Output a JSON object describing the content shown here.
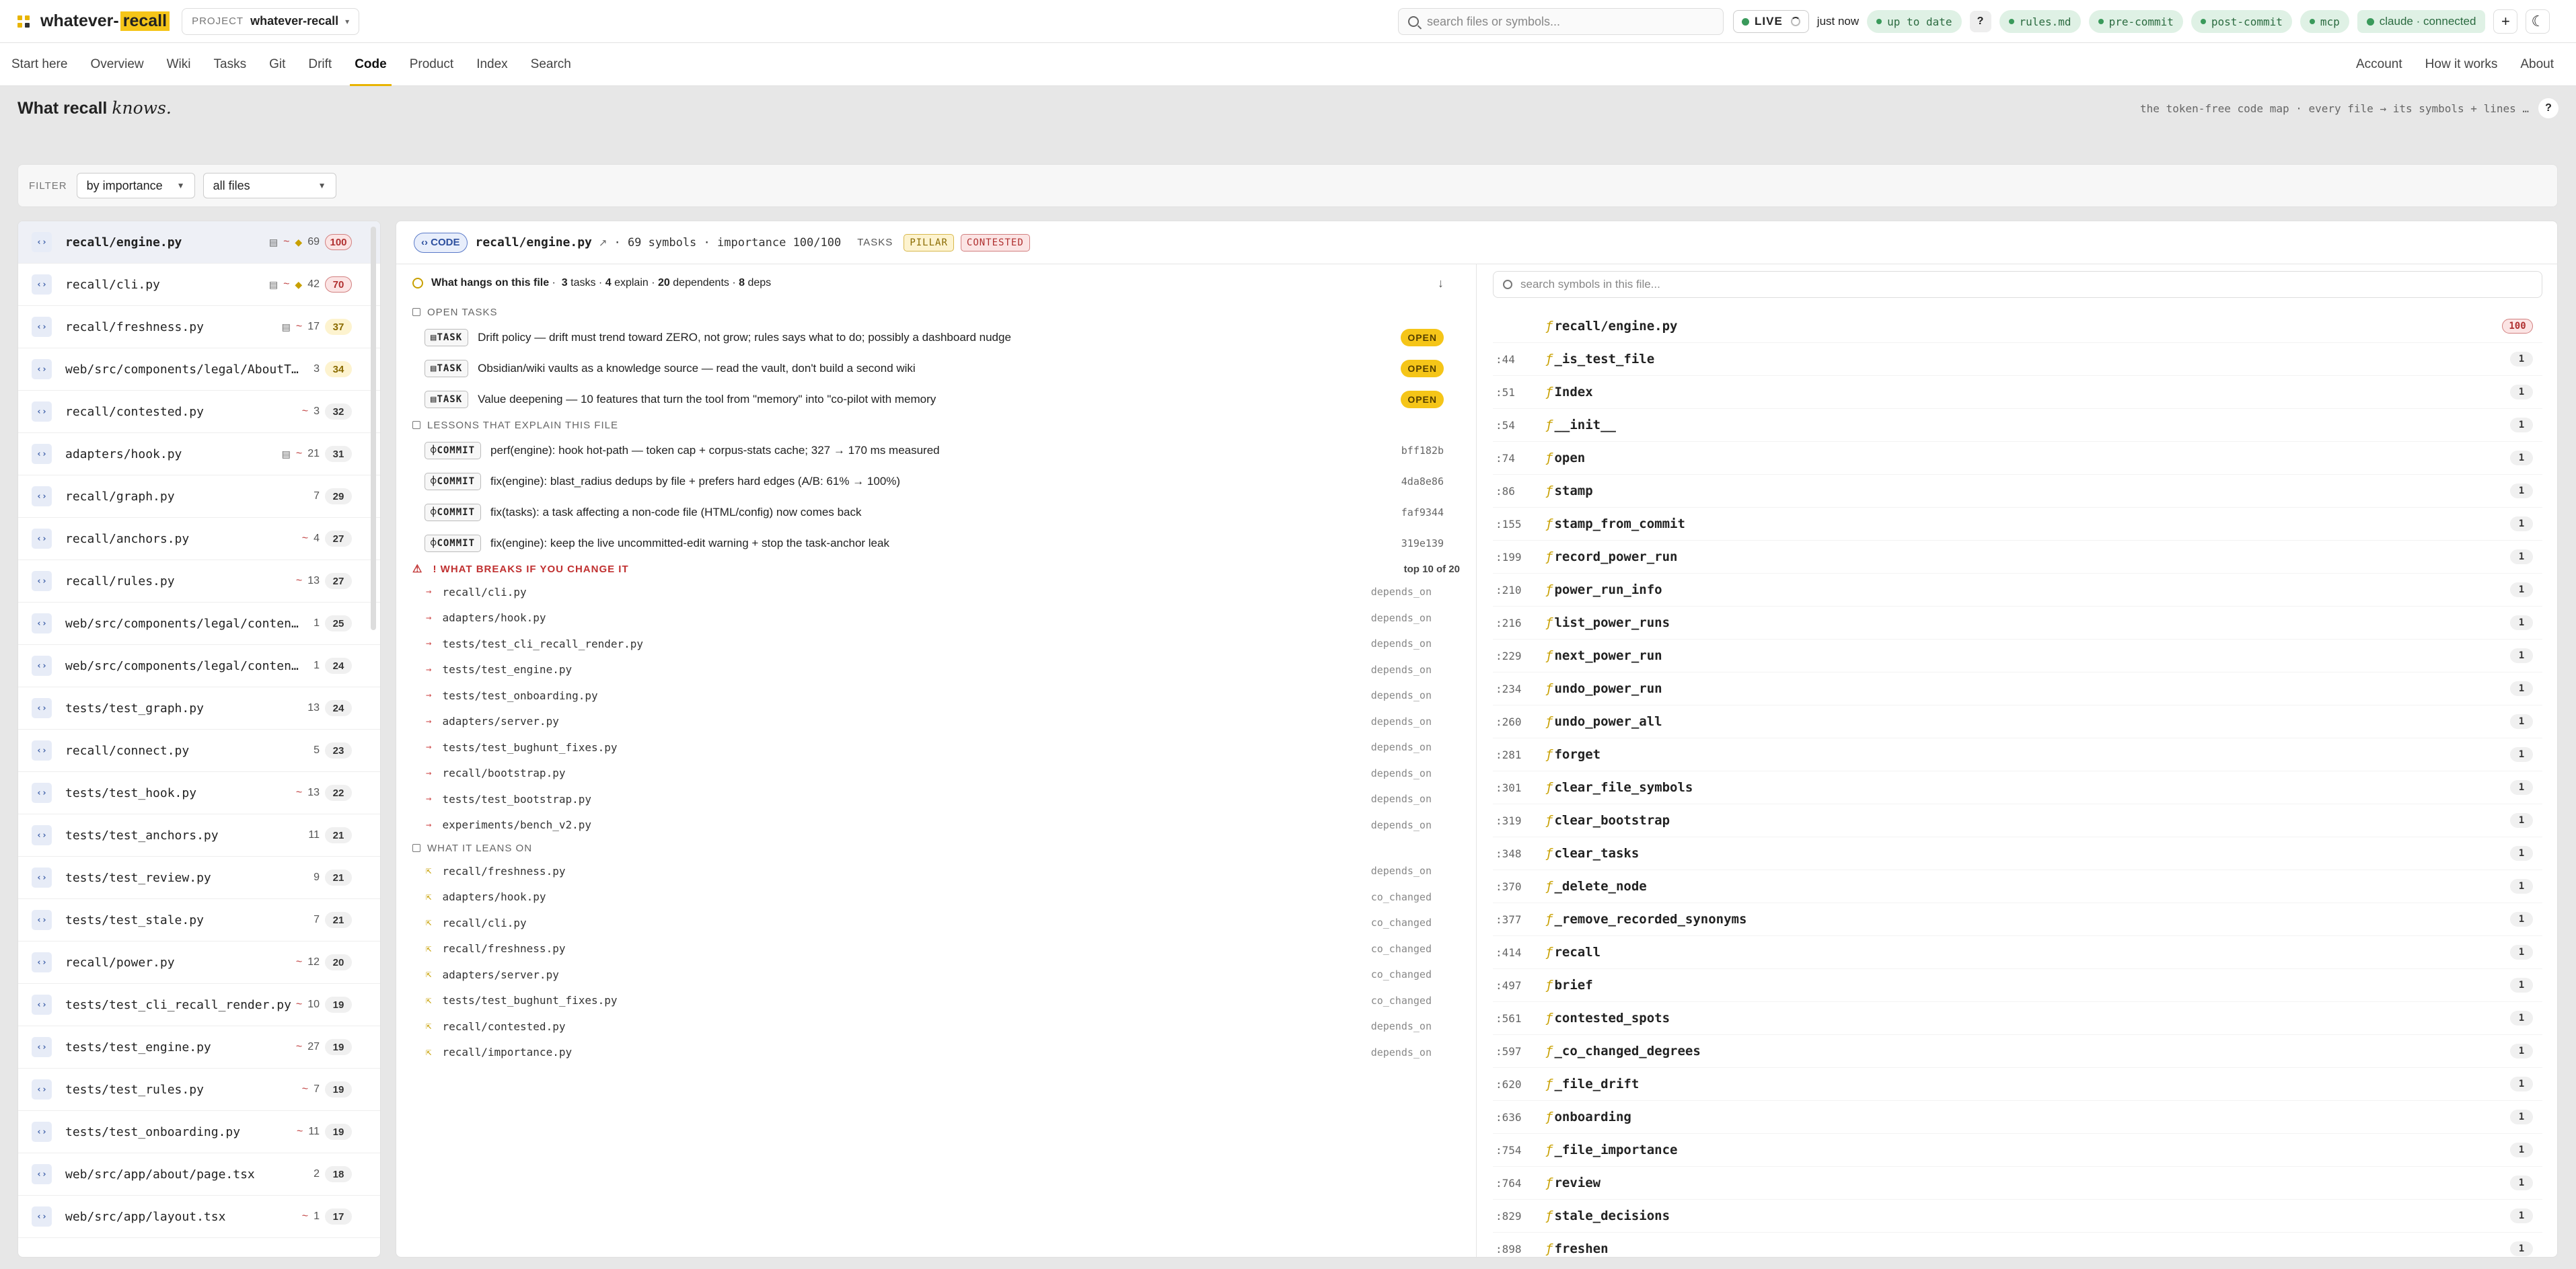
{
  "app": {
    "name_prefix": "whatever-",
    "name_highlight": "recall"
  },
  "project": {
    "label": "PROJECT",
    "value": "whatever-recall"
  },
  "search": {
    "placeholder": "search files or symbols..."
  },
  "status": {
    "live": "LIVE",
    "updated": "just now",
    "up_to_date": "up to date",
    "help": "?",
    "rules": "rules.md",
    "pre_commit": "pre-commit",
    "post_commit": "post-commit",
    "mcp": "mcp",
    "claude": "claude · connected",
    "plus": "+"
  },
  "nav": {
    "items": [
      "Start here",
      "Overview",
      "Wiki",
      "Tasks",
      "Git",
      "Drift",
      "Code",
      "Product",
      "Index",
      "Search"
    ],
    "active": "Code",
    "right": [
      "Account",
      "How it works",
      "About"
    ]
  },
  "page": {
    "title": "What recall",
    "title_em": "knows.",
    "subtitle": "the token-free code map · every file → its symbols + lines …",
    "help": "?"
  },
  "filter": {
    "label": "FILTER",
    "sort": "by importance",
    "scope": "all files"
  },
  "files": [
    {
      "name": "recall/engine.py",
      "doc": "▤",
      "drift": "~",
      "diam": "◆",
      "count": "69",
      "score": "100",
      "tone": "red"
    },
    {
      "name": "recall/cli.py",
      "doc": "▤",
      "drift": "~",
      "diam": "◆",
      "count": "42",
      "score": "70",
      "tone": "red"
    },
    {
      "name": "recall/freshness.py",
      "doc": "▤",
      "drift": "~",
      "diam": "",
      "count": "17",
      "score": "37",
      "tone": "yel"
    },
    {
      "name": "web/src/components/legal/AboutTabs.tsx",
      "doc": "",
      "drift": "",
      "diam": "",
      "count": "3",
      "score": "34",
      "tone": "yel"
    },
    {
      "name": "recall/contested.py",
      "doc": "",
      "drift": "~",
      "diam": "",
      "count": "3",
      "score": "32",
      "tone": ""
    },
    {
      "name": "adapters/hook.py",
      "doc": "▤",
      "drift": "~",
      "diam": "",
      "count": "21",
      "score": "31",
      "tone": ""
    },
    {
      "name": "recall/graph.py",
      "doc": "",
      "drift": "",
      "diam": "",
      "count": "7",
      "score": "29",
      "tone": ""
    },
    {
      "name": "recall/anchors.py",
      "doc": "",
      "drift": "~",
      "diam": "",
      "count": "4",
      "score": "27",
      "tone": ""
    },
    {
      "name": "recall/rules.py",
      "doc": "",
      "drift": "~",
      "diam": "",
      "count": "13",
      "score": "27",
      "tone": ""
    },
    {
      "name": "web/src/components/legal/content/Pr...",
      "doc": "",
      "drift": "",
      "diam": "",
      "count": "1",
      "score": "25",
      "tone": ""
    },
    {
      "name": "web/src/components/legal/content/Im...",
      "doc": "",
      "drift": "",
      "diam": "",
      "count": "1",
      "score": "24",
      "tone": ""
    },
    {
      "name": "tests/test_graph.py",
      "doc": "",
      "drift": "",
      "diam": "",
      "count": "13",
      "score": "24",
      "tone": ""
    },
    {
      "name": "recall/connect.py",
      "doc": "",
      "drift": "",
      "diam": "",
      "count": "5",
      "score": "23",
      "tone": ""
    },
    {
      "name": "tests/test_hook.py",
      "doc": "",
      "drift": "~",
      "diam": "",
      "count": "13",
      "score": "22",
      "tone": ""
    },
    {
      "name": "tests/test_anchors.py",
      "doc": "",
      "drift": "",
      "diam": "",
      "count": "11",
      "score": "21",
      "tone": ""
    },
    {
      "name": "tests/test_review.py",
      "doc": "",
      "drift": "",
      "diam": "",
      "count": "9",
      "score": "21",
      "tone": ""
    },
    {
      "name": "tests/test_stale.py",
      "doc": "",
      "drift": "",
      "diam": "",
      "count": "7",
      "score": "21",
      "tone": ""
    },
    {
      "name": "recall/power.py",
      "doc": "",
      "drift": "~",
      "diam": "",
      "count": "12",
      "score": "20",
      "tone": ""
    },
    {
      "name": "tests/test_cli_recall_render.py",
      "doc": "",
      "drift": "~",
      "diam": "",
      "count": "10",
      "score": "19",
      "tone": ""
    },
    {
      "name": "tests/test_engine.py",
      "doc": "",
      "drift": "~",
      "diam": "",
      "count": "27",
      "score": "19",
      "tone": ""
    },
    {
      "name": "tests/test_rules.py",
      "doc": "",
      "drift": "~",
      "diam": "",
      "count": "7",
      "score": "19",
      "tone": ""
    },
    {
      "name": "tests/test_onboarding.py",
      "doc": "",
      "drift": "~",
      "diam": "",
      "count": "11",
      "score": "19",
      "tone": ""
    },
    {
      "name": "web/src/app/about/page.tsx",
      "doc": "",
      "drift": "",
      "diam": "",
      "count": "2",
      "score": "18",
      "tone": ""
    },
    {
      "name": "web/src/app/layout.tsx",
      "doc": "",
      "drift": "~",
      "diam": "",
      "count": "1",
      "score": "17",
      "tone": ""
    }
  ],
  "detail": {
    "badge": "‹› CODE",
    "path": "recall/engine.py",
    "meta": "· 69 symbols · importance 100/100",
    "tasks_label": "TASKS",
    "tag_pillar": "PILLAR",
    "tag_contested": "CONTESTED",
    "hangs": {
      "prefix": "What hangs on this file",
      "n_tasks": "3",
      "tasks": "tasks ·",
      "n_explain": "4",
      "explain": "explain ·",
      "n_dependents": "20",
      "dependents": "dependents ·",
      "n_deps": "8",
      "deps": "deps"
    },
    "open_tasks_label": "OPEN TASKS",
    "tasks": [
      {
        "chip": "TASK",
        "text": "Drift policy — drift must trend toward ZERO, not grow; rules says what to do; possibly a dashboard nudge",
        "status": "OPEN"
      },
      {
        "chip": "TASK",
        "text": "Obsidian/wiki vaults as a knowledge source — read the vault, don't build a second wiki",
        "status": "OPEN"
      },
      {
        "chip": "TASK",
        "text": "Value deepening — 10 features that turn the tool from \"memory\" into \"co-pilot with memory",
        "status": "OPEN"
      }
    ],
    "lessons_label": "LESSONS THAT EXPLAIN THIS FILE",
    "commits": [
      {
        "chip": "COMMIT",
        "text": "perf(engine): hook hot-path — token cap + corpus-stats cache; 327 → 170 ms measured",
        "sha": "bff182b"
      },
      {
        "chip": "COMMIT",
        "text": "fix(engine): blast_radius dedups by file + prefers hard edges (A/B: 61% → 100%)",
        "sha": "4da8e86"
      },
      {
        "chip": "COMMIT",
        "text": "fix(tasks): a task affecting a non-code file (HTML/config) now comes back",
        "sha": "faf9344"
      },
      {
        "chip": "COMMIT",
        "text": "fix(engine): keep the live uncommitted-edit warning + stop the task-anchor leak",
        "sha": "319e139"
      }
    ],
    "breaks_label": "! WHAT BREAKS IF YOU CHANGE IT",
    "breaks_count": "top 10 of 20",
    "breaks": [
      {
        "file": "recall/cli.py",
        "rel": "depends_on"
      },
      {
        "file": "adapters/hook.py",
        "rel": "depends_on"
      },
      {
        "file": "tests/test_cli_recall_render.py",
        "rel": "depends_on"
      },
      {
        "file": "tests/test_engine.py",
        "rel": "depends_on"
      },
      {
        "file": "tests/test_onboarding.py",
        "rel": "depends_on"
      },
      {
        "file": "adapters/server.py",
        "rel": "depends_on"
      },
      {
        "file": "tests/test_bughunt_fixes.py",
        "rel": "depends_on"
      },
      {
        "file": "recall/bootstrap.py",
        "rel": "depends_on"
      },
      {
        "file": "tests/test_bootstrap.py",
        "rel": "depends_on"
      },
      {
        "file": "experiments/bench_v2.py",
        "rel": "depends_on"
      }
    ],
    "leans_label": "WHAT IT LEANS ON",
    "leans": [
      {
        "file": "recall/freshness.py",
        "rel": "depends_on"
      },
      {
        "file": "adapters/hook.py",
        "rel": "co_changed"
      },
      {
        "file": "recall/cli.py",
        "rel": "co_changed"
      },
      {
        "file": "recall/freshness.py",
        "rel": "co_changed"
      },
      {
        "file": "adapters/server.py",
        "rel": "co_changed"
      },
      {
        "file": "tests/test_bughunt_fixes.py",
        "rel": "co_changed"
      },
      {
        "file": "recall/contested.py",
        "rel": "depends_on"
      },
      {
        "file": "recall/importance.py",
        "rel": "depends_on"
      }
    ],
    "symbol_search_placeholder": "search symbols in this file...",
    "symbols": [
      {
        "line": "",
        "name": "recall/engine.py",
        "count": "100",
        "head": true
      },
      {
        "line": ":44",
        "name": "_is_test_file",
        "count": "1"
      },
      {
        "line": ":51",
        "name": "Index",
        "count": "1"
      },
      {
        "line": ":54",
        "name": "__init__",
        "count": "1"
      },
      {
        "line": ":74",
        "name": "open",
        "count": "1"
      },
      {
        "line": ":86",
        "name": "stamp",
        "count": "1"
      },
      {
        "line": ":155",
        "name": "stamp_from_commit",
        "count": "1"
      },
      {
        "line": ":199",
        "name": "record_power_run",
        "count": "1"
      },
      {
        "line": ":210",
        "name": "power_run_info",
        "count": "1"
      },
      {
        "line": ":216",
        "name": "list_power_runs",
        "count": "1"
      },
      {
        "line": ":229",
        "name": "next_power_run",
        "count": "1"
      },
      {
        "line": ":234",
        "name": "undo_power_run",
        "count": "1"
      },
      {
        "line": ":260",
        "name": "undo_power_all",
        "count": "1"
      },
      {
        "line": ":281",
        "name": "forget",
        "count": "1"
      },
      {
        "line": ":301",
        "name": "clear_file_symbols",
        "count": "1"
      },
      {
        "line": ":319",
        "name": "clear_bootstrap",
        "count": "1"
      },
      {
        "line": ":348",
        "name": "clear_tasks",
        "count": "1"
      },
      {
        "line": ":370",
        "name": "_delete_node",
        "count": "1"
      },
      {
        "line": ":377",
        "name": "_remove_recorded_synonyms",
        "count": "1"
      },
      {
        "line": ":414",
        "name": "recall",
        "count": "1"
      },
      {
        "line": ":497",
        "name": "brief",
        "count": "1"
      },
      {
        "line": ":561",
        "name": "contested_spots",
        "count": "1"
      },
      {
        "line": ":597",
        "name": "_co_changed_degrees",
        "count": "1"
      },
      {
        "line": ":620",
        "name": "_file_drift",
        "count": "1"
      },
      {
        "line": ":636",
        "name": "onboarding",
        "count": "1"
      },
      {
        "line": ":754",
        "name": "_file_importance",
        "count": "1"
      },
      {
        "line": ":764",
        "name": "review",
        "count": "1"
      },
      {
        "line": ":829",
        "name": "stale_decisions",
        "count": "1"
      },
      {
        "line": ":898",
        "name": "freshen",
        "count": "1"
      }
    ]
  }
}
